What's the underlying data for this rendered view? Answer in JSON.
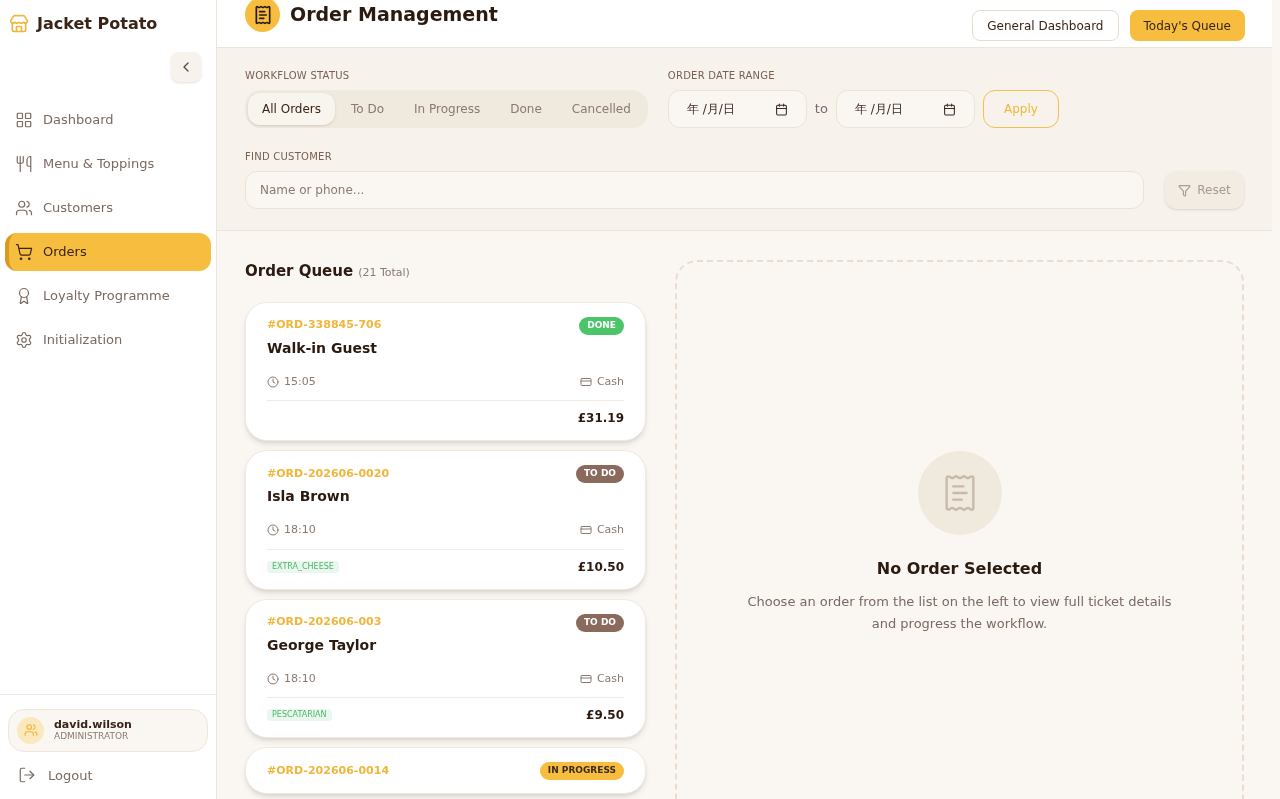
{
  "brand": {
    "name": "Jacket Potato"
  },
  "sidebar": {
    "items": [
      {
        "label": "Dashboard",
        "selected": false
      },
      {
        "label": "Menu & Toppings",
        "selected": false
      },
      {
        "label": "Customers",
        "selected": false
      },
      {
        "label": "Orders",
        "selected": true
      },
      {
        "label": "Loyalty Programme",
        "selected": false
      },
      {
        "label": "Initialization",
        "selected": false
      }
    ]
  },
  "user": {
    "name": "david.wilson",
    "role": "ADMINISTRATOR"
  },
  "logout": "Logout",
  "header": {
    "title": "Order Management",
    "buttons": [
      {
        "label": "General Dashboard",
        "kind": "outline"
      },
      {
        "label": "Today's Queue",
        "kind": "primary"
      }
    ]
  },
  "filters": {
    "status_label": "WORKFLOW STATUS",
    "statuses": [
      {
        "label": "All Orders",
        "selected": true
      },
      {
        "label": "To Do",
        "selected": false
      },
      {
        "label": "In Progress",
        "selected": false
      },
      {
        "label": "Done",
        "selected": false
      },
      {
        "label": "Cancelled",
        "selected": false
      }
    ],
    "date_label": "ORDER DATE RANGE",
    "date_from": {
      "placeholder": "年 /月/日"
    },
    "date_sep": "to",
    "date_to": {
      "placeholder": "年 /月/日"
    },
    "apply": "Apply",
    "customer_label": "FIND CUSTOMER",
    "customer": {
      "placeholder": "Name or phone..."
    },
    "reset": {
      "label": "Reset",
      "disabled": true
    }
  },
  "queue": {
    "title": "Order Queue",
    "count": "(21 Total)",
    "orders": [
      {
        "id": "#ORD-338845-706",
        "status": "DONE",
        "kind": "done",
        "customer": "Walk-in Guest",
        "time": "15:05",
        "payment": "Cash",
        "total": "£31.19"
      },
      {
        "id": "#ORD-202606-0020",
        "status": "TO DO",
        "kind": "todo",
        "customer": "Isla Brown",
        "time": "18:10",
        "payment": "Cash",
        "tag": "EXTRA_CHEESE",
        "total": "£10.50"
      },
      {
        "id": "#ORD-202606-003",
        "status": "TO DO",
        "kind": "todo",
        "customer": "George Taylor",
        "time": "18:10",
        "payment": "Cash",
        "tag": "PESCATARIAN",
        "total": "£9.50"
      },
      {
        "id": "#ORD-202606-0014",
        "status": "IN PROGRESS",
        "kind": "progress"
      }
    ]
  },
  "detail": {
    "title": "No Order Selected",
    "text": "Choose an order from the list on the left to view full ticket details and progress the workflow."
  }
}
